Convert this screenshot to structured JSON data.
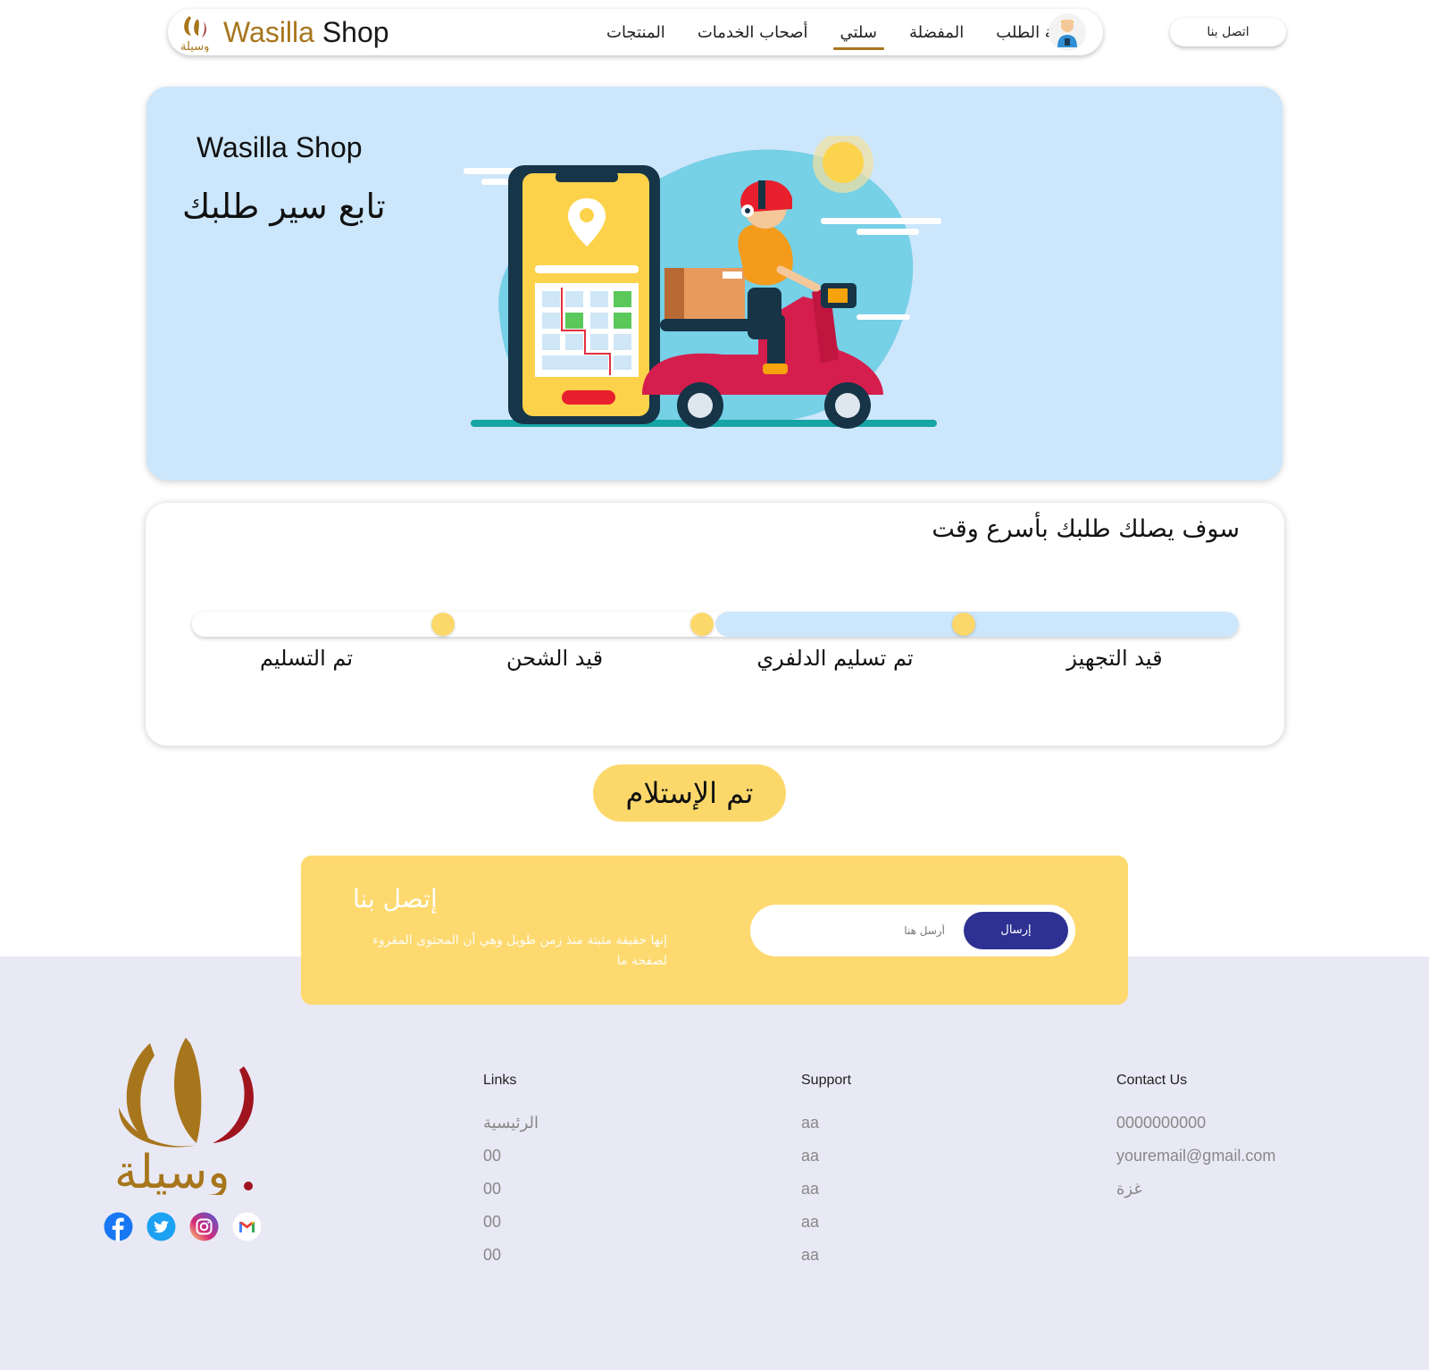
{
  "nav": {
    "brand_part1": "Wasilla",
    "brand_part2": "Shop",
    "items": [
      {
        "label": "حالة الطلب",
        "active": false
      },
      {
        "label": "المفضلة",
        "active": false
      },
      {
        "label": "سلتي",
        "active": true
      },
      {
        "label": "أصحاب الخدمات",
        "active": false
      },
      {
        "label": "المنتجات",
        "active": false
      }
    ],
    "contact_label": "اتصل بنا"
  },
  "hero": {
    "title": "Wasilla Shop",
    "subtitle": "تابع سير طلبك"
  },
  "progress": {
    "heading": "سوف يصلك طلبك بأسرع وقت",
    "fill_fraction": 0.5,
    "steps": [
      "قيد التجهيز",
      "تم تسليم الدلفري",
      "قيد الشحن",
      "تم التسليم"
    ]
  },
  "received_label": "تم الإستلام",
  "contact_box": {
    "title": "إتصل بنا",
    "description": "إنها حقيقة مثبتة منذ زمن طويل وهي أن المحتوى المقروء لصفحة ما",
    "input_placeholder": "أرسل هنا",
    "send_label": "إرسال"
  },
  "footer": {
    "links": {
      "title": "Links",
      "items": [
        "الرئيسية",
        "00",
        "00",
        "00",
        "00"
      ]
    },
    "support": {
      "title": "Support",
      "items": [
        "aa",
        "aa",
        "aa",
        "aa",
        "aa"
      ]
    },
    "contact": {
      "title": "Contact Us",
      "items": [
        "0000000000",
        "youremail@gmail.com",
        "غزة"
      ]
    },
    "socials": [
      "facebook-icon",
      "twitter-icon",
      "instagram-icon",
      "gmail-icon"
    ]
  },
  "colors": {
    "gold": "#a7761c",
    "hero_bg": "#cce6fb",
    "yellow": "#fcd86b",
    "navy": "#2e3192",
    "footer_bg": "#e9e9f5"
  }
}
